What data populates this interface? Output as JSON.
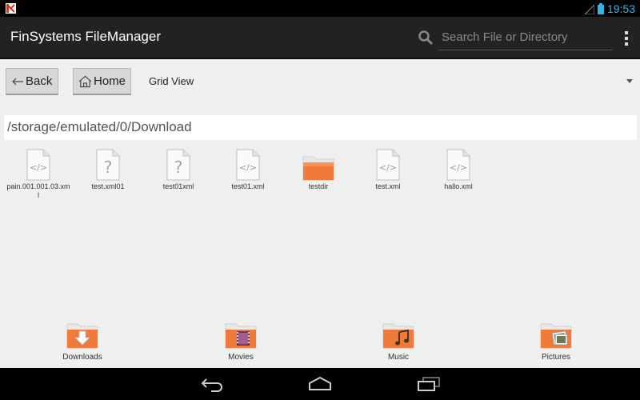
{
  "status": {
    "clock": "19:53"
  },
  "app": {
    "title": "FinSystems FileManager"
  },
  "search": {
    "placeholder": "Search File or Directory"
  },
  "toolbar": {
    "back_label": "Back",
    "home_label": "Home",
    "view_mode": "Grid View"
  },
  "path": "/storage/emulated/0/Download",
  "files": [
    {
      "name": "pain.001.001.03.xml",
      "icon": "xml-file-icon"
    },
    {
      "name": "test.xml01",
      "icon": "unknown-file-icon"
    },
    {
      "name": "test01xml",
      "icon": "unknown-file-icon"
    },
    {
      "name": "test01.xml",
      "icon": "xml-file-icon"
    },
    {
      "name": "testdir",
      "icon": "folder-icon"
    },
    {
      "name": "test.xml",
      "icon": "xml-file-icon"
    },
    {
      "name": "hallo.xml",
      "icon": "xml-file-icon"
    }
  ],
  "shortcuts": [
    {
      "label": "Downloads",
      "icon": "downloads-folder-icon"
    },
    {
      "label": "Movies",
      "icon": "movies-folder-icon"
    },
    {
      "label": "Music",
      "icon": "music-folder-icon"
    },
    {
      "label": "Pictures",
      "icon": "pictures-folder-icon"
    }
  ],
  "colors": {
    "accent": "#33b5e5",
    "folder": "#f07a3a",
    "actionbar": "#222222"
  }
}
